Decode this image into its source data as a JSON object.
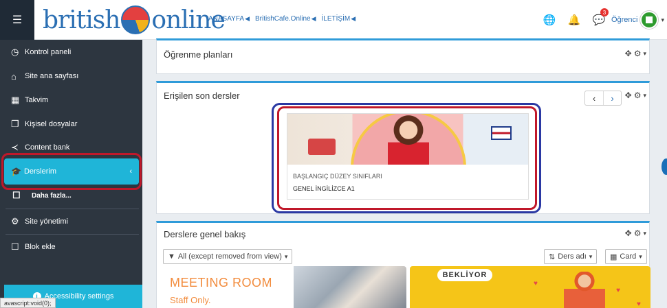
{
  "navbar": {
    "logo_left": "british",
    "logo_right": "online",
    "links": [
      "ANASAYFA",
      "BritishCafe.Online",
      "İLETİŞİM"
    ],
    "notification_count": "3",
    "user_name": "Öğrenci"
  },
  "sidebar": {
    "items": [
      {
        "label": "Kontrol paneli",
        "icon": "dashboard-icon"
      },
      {
        "label": "Site ana sayfası",
        "icon": "home-icon"
      },
      {
        "label": "Takvim",
        "icon": "calendar-icon"
      },
      {
        "label": "Kişisel dosyalar",
        "icon": "files-icon"
      },
      {
        "label": "Content bank",
        "icon": "share-icon"
      },
      {
        "label": "Derslerim",
        "icon": "graduation-cap-icon"
      },
      {
        "label": "Daha fazla...",
        "icon": "folder-icon"
      },
      {
        "label": "Site yönetimi",
        "icon": "gear-icon"
      },
      {
        "label": "Blok ekle",
        "icon": "folder-icon"
      }
    ],
    "accessibility_label": "Accessibility settings"
  },
  "status_bar": "avascript:void(0);",
  "cards": {
    "learning_plans_title": "Öğrenme planları",
    "recent_courses_title": "Erişilen son dersler",
    "recent_course": {
      "category": "BAŞLANGIÇ DÜZEY SINIFLARI",
      "name": "GENEL İNGİLİZCE A1"
    },
    "overview_title": "Derslere genel bakış",
    "filter_label": "All (except removed from view)",
    "sort_label": "Ders adı",
    "view_label": "Card",
    "tile1_title": "MEETING ROOM",
    "tile1_subtitle": "Staff Only.",
    "tile2_badge": "BEKLİYOR"
  }
}
